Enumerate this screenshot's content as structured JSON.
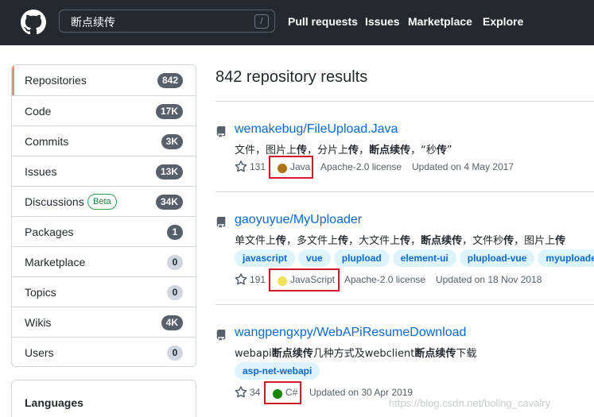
{
  "header": {
    "search_value": "断点续传",
    "search_shortcut": "/",
    "nav": [
      "Pull requests",
      "Issues",
      "Marketplace",
      "Explore"
    ]
  },
  "sidebar": {
    "items": [
      {
        "label": "Repositories",
        "count": "842",
        "active": true,
        "dark": true
      },
      {
        "label": "Code",
        "count": "17K",
        "dark": true
      },
      {
        "label": "Commits",
        "count": "3K",
        "dark": true
      },
      {
        "label": "Issues",
        "count": "13K",
        "dark": true
      },
      {
        "label": "Discussions",
        "badge": "Beta",
        "count": "34K",
        "dark": true
      },
      {
        "label": "Packages",
        "count": "1",
        "dark": true
      },
      {
        "label": "Marketplace",
        "count": "0"
      },
      {
        "label": "Topics",
        "count": "0"
      },
      {
        "label": "Wikis",
        "count": "4K",
        "dark": true
      },
      {
        "label": "Users",
        "count": "0"
      }
    ],
    "languages_title": "Languages"
  },
  "results": {
    "title": "842 repository results",
    "repos": [
      {
        "name": "wemakebug/FileUpload.Java",
        "description_html": "文件，图片上<b>传</b>，分片上<b>传</b>，<b>断点续传</b>，“秒<b>传</b>”",
        "stars": "131",
        "language": "Java",
        "language_color": "#b07219",
        "license": "Apache-2.0 license",
        "updated": "Updated on 4 May 2017",
        "tags": []
      },
      {
        "name": "gaoyuyue/MyUploader",
        "description_html": "单文件上<b>传</b>，多文件上<b>传</b>，大文件上<b>传</b>，<b>断点续传</b>，文件秒<b>传</b>，图片上<b>传</b>",
        "stars": "191",
        "language": "JavaScript",
        "language_color": "#f1e05a",
        "license": "Apache-2.0 license",
        "updated": "Updated on 18 Nov 2018",
        "tags": [
          "javascript",
          "vue",
          "plupload",
          "element-ui",
          "plupload-vue",
          "myuploader"
        ]
      },
      {
        "name": "wangpengxpy/WebAPiResumeDownload",
        "description_html": "webapi<b>断点续传</b>几种方式及webclient<b>断点续传</b>下载",
        "stars": "34",
        "language": "C#",
        "language_color": "#178600",
        "license": "",
        "updated": "Updated on 30 Apr 2019",
        "tags": [
          "asp-net-webapi"
        ]
      }
    ]
  },
  "watermark": "https://blog.csdn.net/boling_cavalry",
  "colors": {
    "header_bg": "#24292f",
    "link": "#0969da",
    "topic_bg": "#ddf4ff",
    "highlight_box": "#d11a2a",
    "active_border": "#fd8c73"
  }
}
